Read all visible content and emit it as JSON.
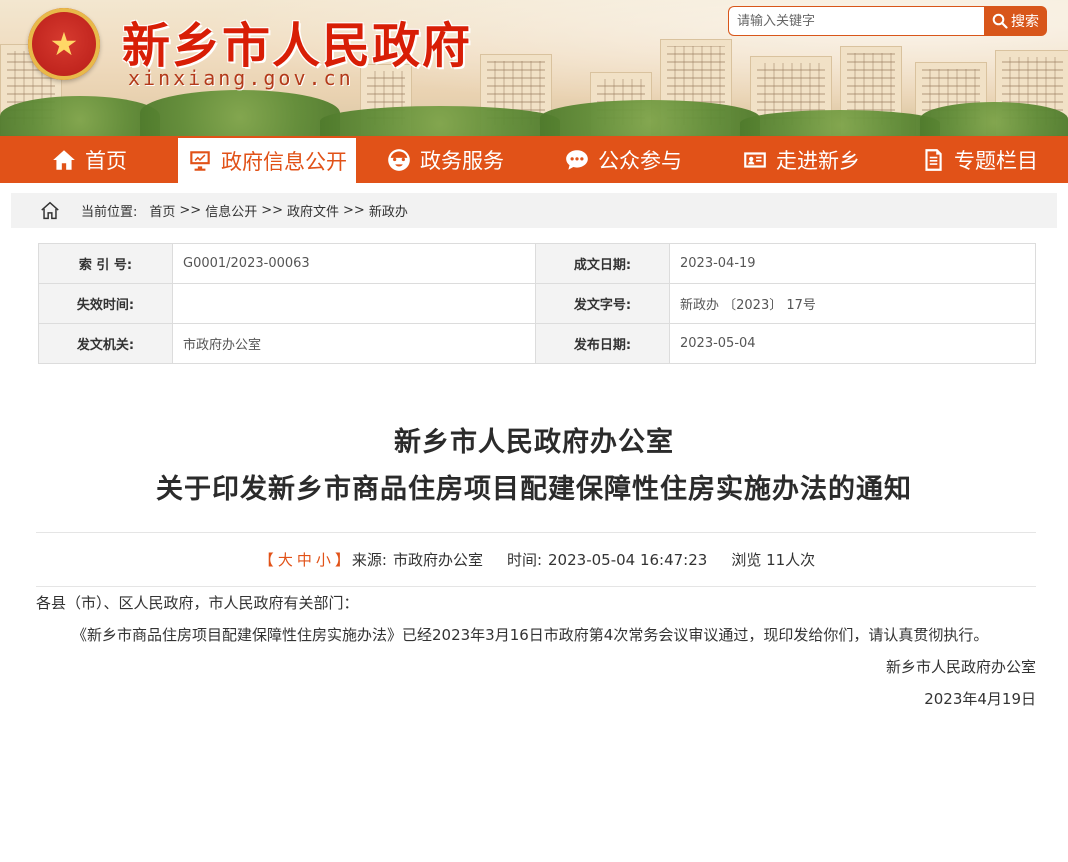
{
  "header": {
    "emblem_glyph": "★",
    "site_title": "新乡市人民政府",
    "site_domain": "xinxiang.gov.cn",
    "search_placeholder": "请输入关键字",
    "search_button": "搜索"
  },
  "nav": {
    "items": [
      {
        "label": "首页",
        "icon": "home-icon"
      },
      {
        "label": "政府信息公开",
        "icon": "monitor-icon",
        "active": true
      },
      {
        "label": "政务服务",
        "icon": "service-icon"
      },
      {
        "label": "公众参与",
        "icon": "chat-icon"
      },
      {
        "label": "走进新乡",
        "icon": "id-card-icon"
      },
      {
        "label": "专题栏目",
        "icon": "document-icon"
      }
    ],
    "accent_color": "#e15218"
  },
  "breadcrumb": {
    "prefix": "当前位置:",
    "items": [
      "首页",
      "信息公开",
      "政府文件",
      "新政办"
    ],
    "separator": ">>"
  },
  "meta": {
    "index_label": "索 引 号:",
    "index_value": "G0001/2023-00063",
    "written_date_label": "成文日期:",
    "written_date_value": "2023-04-19",
    "expiry_label": "失效时间:",
    "expiry_value": "",
    "doc_no_label": "发文字号:",
    "doc_no_value": "新政办 〔2023〕 17号",
    "issuer_label": "发文机关:",
    "issuer_value": "市政府办公室",
    "publish_label": "发布日期:",
    "publish_value": "2023-05-04"
  },
  "article": {
    "title_line1": "新乡市人民政府办公室",
    "title_line2": "关于印发新乡市商品住房项目配建保障性住房实施办法的通知",
    "font_size_bracket_open": "【",
    "font_large": "大",
    "font_medium": "中",
    "font_small": "小",
    "font_size_bracket_close": "】",
    "source_label": "来源:",
    "source_value": "市政府办公室",
    "time_label": "时间:",
    "time_value": "2023-05-04 16:47:23",
    "views_text": "浏览 11人次",
    "addressee": "各县（市）、区人民政府，市人民政府有关部门：",
    "paragraph": "《新乡市商品住房项目配建保障性住房实施办法》已经2023年3月16日市政府第4次常务会议审议通过，现印发给你们，请认真贯彻执行。",
    "signature": "新乡市人民政府办公室",
    "date": "2023年4月19日"
  }
}
